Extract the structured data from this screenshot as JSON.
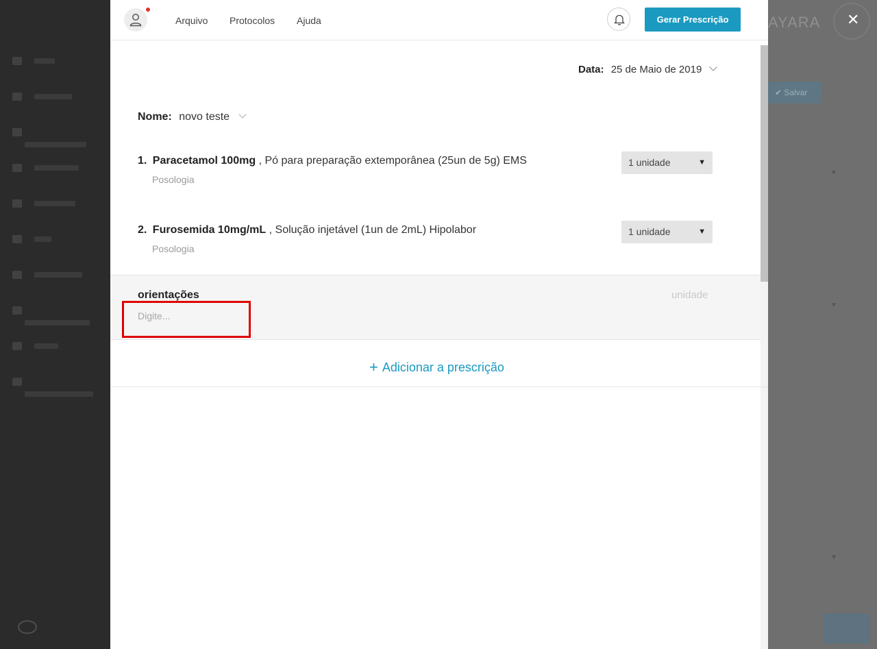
{
  "background": {
    "brand_partial": "AYARA",
    "save_label": "Salvar"
  },
  "topbar": {
    "menu": [
      "Arquivo",
      "Protocolos",
      "Ajuda"
    ],
    "generate_label": "Gerar Prescrição"
  },
  "prescription": {
    "date_label": "Data:",
    "date_value": "25 de Maio de 2019",
    "name_label": "Nome:",
    "name_value": "novo teste",
    "items": [
      {
        "number": "1.",
        "name": "Paracetamol 100mg",
        "description": ", Pó para preparação extemporânea (25un de 5g) EMS",
        "posologia": "Posologia",
        "quantity": "1 unidade"
      },
      {
        "number": "2.",
        "name": "Furosemida 10mg/mL",
        "description": ", Solução injetável (1un de 2mL) Hipolabor",
        "posologia": "Posologia",
        "quantity": "1 unidade"
      }
    ],
    "orientations": {
      "title": "orientações",
      "unit": "unidade",
      "placeholder": "Digite...",
      "value": ""
    },
    "add_label": "Adicionar a prescrição"
  },
  "colors": {
    "accent": "#1a9ac1",
    "highlight": "#e00000",
    "notification": "#e2322c"
  }
}
